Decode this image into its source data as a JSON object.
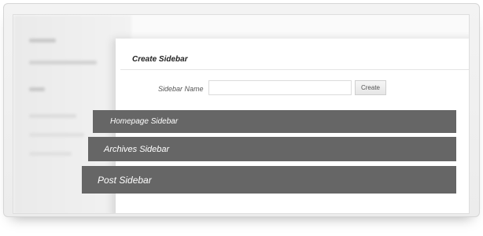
{
  "create_section": {
    "title": "Create Sidebar",
    "name_label": "Sidebar Name",
    "name_value": "",
    "name_placeholder": "",
    "create_button": "Create"
  },
  "sidebars": [
    {
      "label": "Homepage Sidebar"
    },
    {
      "label": "Archives Sidebar"
    },
    {
      "label": "Post Sidebar"
    }
  ]
}
